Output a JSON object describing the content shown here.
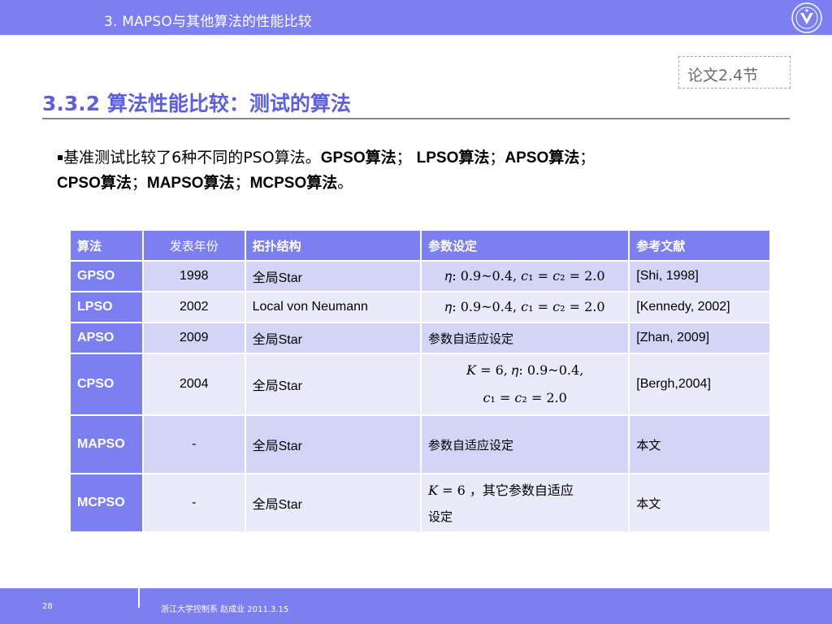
{
  "header": {
    "title": "3. MAPSO与其他算法的性能比较"
  },
  "ref_note": "论文2.4节",
  "heading": "3.3.2 算法性能比较：测试的算法",
  "bullet": {
    "mark": "▪",
    "intro": "基准测试比较了6种不同的PSO算法。",
    "algo1": "GPSO算法",
    "sep1": "；  ",
    "algo2": "LPSO算法",
    "sep2": "；",
    "algo3": "APSO算法",
    "sep3": "；",
    "algo4": "CPSO算法",
    "sep4": "；",
    "algo5": "MAPSO算法",
    "sep5": "；",
    "algo6": "MCPSO算法",
    "end": "。"
  },
  "table": {
    "headers": [
      "算法",
      "发表年份",
      "拓扑结构",
      "参数设定",
      "参考文献"
    ],
    "rows": [
      {
        "name": "GPSO",
        "year": "1998",
        "topology": "全局Star",
        "param": "𝜂: 0.9~0.4, 𝑐₁ = 𝑐₂ = 2.0",
        "param2": "",
        "ref": "[Shi, 1998]"
      },
      {
        "name": "LPSO",
        "year": "2002",
        "topology": "Local von Neumann",
        "param": "𝜂: 0.9~0.4, 𝑐₁ = 𝑐₂ = 2.0",
        "param2": "",
        "ref": "[Kennedy, 2002]"
      },
      {
        "name": "APSO",
        "year": "2009",
        "topology": "全局Star",
        "param": "参数自适应设定",
        "param2": "",
        "ref": "[Zhan, 2009]"
      },
      {
        "name": "CPSO",
        "year": "2004",
        "topology": "全局Star",
        "param": "𝐾 = 6, 𝜂: 0.9~0.4,",
        "param2": "𝑐₁ = 𝑐₂ = 2.0",
        "ref": "[Bergh,2004]"
      },
      {
        "name": "MAPSO",
        "year": "-",
        "topology": "全局Star",
        "param": "参数自适应设定",
        "param2": "",
        "ref": "本文"
      },
      {
        "name": "MCPSO",
        "year": "-",
        "topology": "全局Star",
        "param": "𝐾 = 6    ，其它参数自适应",
        "param2": "设定",
        "ref": "本文"
      }
    ]
  },
  "footer": {
    "page": "28",
    "info": "浙江大学控制系 赵成业 2011.3.15"
  },
  "colors": {
    "accent": "#7b7ff0",
    "heading": "#5b5fe0",
    "row_odd": "#d4d4f6",
    "row_even": "#eaeafb"
  }
}
